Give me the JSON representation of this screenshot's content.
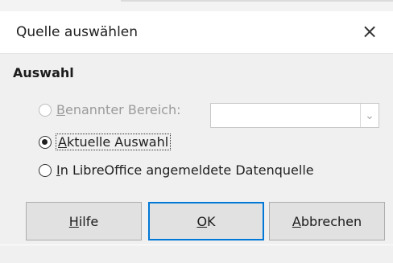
{
  "dialog": {
    "title": "Quelle auswählen",
    "close_label": "×"
  },
  "section": {
    "title": "Auswahl"
  },
  "options": [
    {
      "label": "Benannter Bereich:",
      "accel": "B",
      "rest": "enannter Bereich:",
      "checked": false,
      "enabled": false
    },
    {
      "label": "Aktuelle Auswahl",
      "accel": "A",
      "rest": "ktuelle Auswahl",
      "checked": true,
      "enabled": true
    },
    {
      "label": "In LibreOffice angemeldete Datenquelle",
      "accel": "I",
      "rest": "n LibreOffice angemeldete Datenquelle",
      "checked": false,
      "enabled": true
    }
  ],
  "combo": {
    "value": "",
    "arrow_icon": "chevron-down-icon"
  },
  "buttons": {
    "help": {
      "label": "Hilfe",
      "accel": "H",
      "rest": "ilfe"
    },
    "ok": {
      "label": "OK",
      "accel": "O",
      "rest": "K"
    },
    "cancel": {
      "label": "Abbrechen",
      "accel": "A",
      "rest": "bbrechen"
    }
  },
  "colors": {
    "accent": "#0078d7",
    "dialog_bg": "#f0f0f0",
    "button_bg": "#e1e1e1"
  }
}
